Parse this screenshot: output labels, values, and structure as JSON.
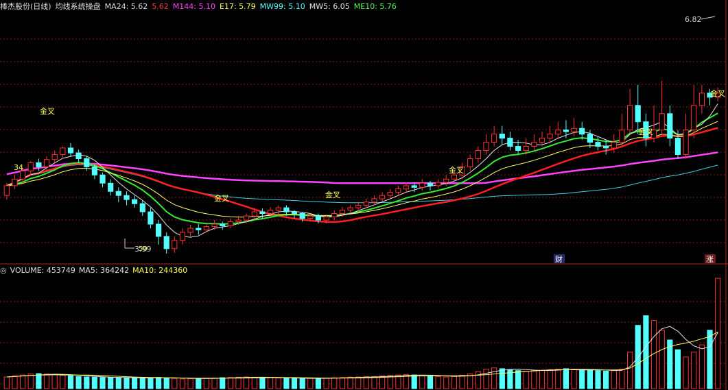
{
  "header": {
    "stock_name": "棒杰股份(日线)",
    "indicator_name": "均线系统操盘",
    "mas": [
      {
        "label": "MA24: 5.62",
        "color": "#dcdcdc"
      },
      {
        "label": "5.62",
        "color": "#ff3b3b"
      },
      {
        "label": "M144: 5.10",
        "color": "#ff44ff"
      },
      {
        "label": "E17: 5.79",
        "color": "#ffff55"
      },
      {
        "label": "MW99: 5.10",
        "color": "#55ffff"
      },
      {
        "label": "MW5: 6.05",
        "color": "#e8e8e8"
      },
      {
        "label": "ME10: 5.76",
        "color": "#55ff55"
      }
    ]
  },
  "annotations": {
    "high_price": "6.82",
    "low_price": "3.99",
    "left_value": "34",
    "low_marker": "50",
    "golden_cross": "金叉",
    "cai_marker": "财",
    "zhang_marker": "涨"
  },
  "volume_header": {
    "volume_label": "VOLUME: 453749",
    "ma5_label": "MA5: 364242",
    "ma10_label": "MA10: 244360"
  },
  "colors": {
    "up": "#ff3232",
    "down": "#54ffff",
    "grid": "#8a1c1c",
    "ma144": "#ff44ff",
    "mw99": "#40d0e0",
    "ma24": "#ff2020",
    "me10": "#33ee33",
    "e17": "#ffff66",
    "mw5": "#e8e8e8"
  },
  "chart_data": {
    "type": "candlestick",
    "price_range": [
      3.99,
      6.82
    ],
    "candles": [
      [
        4.7,
        4.82,
        4.65,
        4.85
      ],
      [
        4.82,
        4.9,
        4.78,
        4.95
      ],
      [
        4.9,
        5.0,
        4.85,
        5.04
      ],
      [
        5.0,
        5.1,
        4.95,
        5.12
      ],
      [
        5.1,
        5.05,
        5.0,
        5.15
      ],
      [
        5.05,
        5.14,
        5.0,
        5.18
      ],
      [
        5.14,
        5.2,
        5.1,
        5.25
      ],
      [
        5.2,
        5.28,
        5.15,
        5.3
      ],
      [
        5.28,
        5.22,
        5.18,
        5.34
      ],
      [
        5.22,
        5.15,
        5.1,
        5.26
      ],
      [
        5.15,
        5.05,
        5.0,
        5.18
      ],
      [
        5.05,
        4.95,
        4.9,
        5.08
      ],
      [
        4.95,
        4.85,
        4.8,
        4.98
      ],
      [
        4.85,
        4.75,
        4.7,
        4.9
      ],
      [
        4.75,
        4.7,
        4.62,
        4.8
      ],
      [
        4.7,
        4.65,
        4.58,
        4.75
      ],
      [
        4.65,
        4.6,
        4.55,
        4.7
      ],
      [
        4.6,
        4.5,
        4.45,
        4.64
      ],
      [
        4.5,
        4.35,
        4.3,
        4.55
      ],
      [
        4.35,
        4.2,
        4.1,
        4.4
      ],
      [
        4.2,
        4.05,
        3.99,
        4.25
      ],
      [
        4.05,
        4.15,
        4.0,
        4.2
      ],
      [
        4.15,
        4.25,
        4.1,
        4.3
      ],
      [
        4.25,
        4.3,
        4.2,
        4.34
      ],
      [
        4.3,
        4.28,
        4.22,
        4.35
      ],
      [
        4.28,
        4.32,
        4.25,
        4.36
      ],
      [
        4.32,
        4.35,
        4.28,
        4.4
      ],
      [
        4.35,
        4.33,
        4.28,
        4.38
      ],
      [
        4.33,
        4.38,
        4.3,
        4.42
      ],
      [
        4.38,
        4.4,
        4.34,
        4.45
      ],
      [
        4.4,
        4.45,
        4.36,
        4.48
      ],
      [
        4.45,
        4.5,
        4.4,
        4.55
      ],
      [
        4.5,
        4.48,
        4.42,
        4.54
      ],
      [
        4.48,
        4.52,
        4.44,
        4.56
      ],
      [
        4.52,
        4.55,
        4.46,
        4.58
      ],
      [
        4.55,
        4.5,
        4.45,
        4.58
      ],
      [
        4.5,
        4.48,
        4.42,
        4.52
      ],
      [
        4.48,
        4.42,
        4.38,
        4.5
      ],
      [
        4.42,
        4.45,
        4.38,
        4.48
      ],
      [
        4.45,
        4.4,
        4.36,
        4.48
      ],
      [
        4.4,
        4.44,
        4.36,
        4.47
      ],
      [
        4.44,
        4.48,
        4.4,
        4.52
      ],
      [
        4.48,
        4.52,
        4.44,
        4.56
      ],
      [
        4.52,
        4.55,
        4.48,
        4.58
      ],
      [
        4.55,
        4.58,
        4.5,
        4.62
      ],
      [
        4.58,
        4.62,
        4.54,
        4.66
      ],
      [
        4.62,
        4.66,
        4.58,
        4.7
      ],
      [
        4.66,
        4.7,
        4.62,
        4.74
      ],
      [
        4.7,
        4.74,
        4.66,
        4.78
      ],
      [
        4.74,
        4.78,
        4.7,
        4.82
      ],
      [
        4.78,
        4.82,
        4.74,
        4.86
      ],
      [
        4.82,
        4.8,
        4.74,
        4.86
      ],
      [
        4.8,
        4.85,
        4.76,
        4.9
      ],
      [
        4.85,
        4.82,
        4.76,
        4.88
      ],
      [
        4.82,
        4.86,
        4.78,
        4.9
      ],
      [
        4.86,
        4.9,
        4.82,
        4.95
      ],
      [
        4.9,
        4.95,
        4.86,
        5.0
      ],
      [
        4.95,
        5.05,
        4.9,
        5.1
      ],
      [
        5.05,
        5.15,
        5.0,
        5.2
      ],
      [
        5.15,
        5.25,
        5.1,
        5.3
      ],
      [
        5.25,
        5.35,
        5.2,
        5.45
      ],
      [
        5.35,
        5.45,
        5.3,
        5.55
      ],
      [
        5.45,
        5.4,
        5.32,
        5.55
      ],
      [
        5.4,
        5.3,
        5.25,
        5.48
      ],
      [
        5.3,
        5.25,
        5.2,
        5.38
      ],
      [
        5.25,
        5.3,
        5.2,
        5.4
      ],
      [
        5.3,
        5.35,
        5.25,
        5.45
      ],
      [
        5.35,
        5.4,
        5.3,
        5.48
      ],
      [
        5.4,
        5.45,
        5.35,
        5.55
      ],
      [
        5.45,
        5.5,
        5.4,
        5.6
      ],
      [
        5.5,
        5.48,
        5.4,
        5.62
      ],
      [
        5.48,
        5.52,
        5.42,
        5.65
      ],
      [
        5.52,
        5.45,
        5.38,
        5.6
      ],
      [
        5.45,
        5.35,
        5.28,
        5.5
      ],
      [
        5.35,
        5.3,
        5.25,
        5.42
      ],
      [
        5.3,
        5.28,
        5.2,
        5.38
      ],
      [
        5.28,
        5.35,
        5.22,
        5.45
      ],
      [
        5.35,
        5.5,
        5.3,
        5.7
      ],
      [
        5.5,
        5.8,
        5.45,
        6.0
      ],
      [
        5.8,
        5.6,
        5.45,
        6.05
      ],
      [
        5.6,
        5.4,
        5.3,
        5.7
      ],
      [
        5.4,
        5.5,
        5.35,
        5.8
      ],
      [
        5.5,
        5.7,
        5.45,
        6.1
      ],
      [
        5.7,
        5.4,
        5.3,
        5.8
      ],
      [
        5.4,
        5.2,
        5.15,
        5.5
      ],
      [
        5.2,
        5.5,
        5.15,
        5.7
      ],
      [
        5.5,
        5.8,
        5.4,
        6.05
      ],
      [
        5.8,
        5.95,
        5.7,
        6.05
      ],
      [
        5.95,
        5.9,
        5.8,
        6.0
      ],
      [
        5.9,
        5.95,
        5.85,
        6.02
      ]
    ],
    "volumes": [
      48000,
      52000,
      56000,
      60000,
      62000,
      60000,
      58000,
      55000,
      53000,
      50000,
      48000,
      47000,
      46000,
      45000,
      45000,
      44000,
      44000,
      43000,
      45000,
      46000,
      44000,
      42000,
      40000,
      41000,
      42000,
      43000,
      44000,
      45000,
      46000,
      47000,
      48000,
      47000,
      46000,
      45000,
      44000,
      43000,
      42000,
      41000,
      42000,
      43000,
      44000,
      45000,
      46000,
      47000,
      48000,
      49000,
      50000,
      52000,
      54000,
      56000,
      58000,
      56000,
      54000,
      52000,
      50000,
      48000,
      50000,
      55000,
      60000,
      70000,
      80000,
      85000,
      82000,
      78000,
      74000,
      72000,
      74000,
      76000,
      78000,
      80000,
      82000,
      80000,
      78000,
      76000,
      74000,
      72000,
      74000,
      80000,
      150000,
      260000,
      300000,
      280000,
      240000,
      200000,
      160000,
      130000,
      150000,
      180000,
      240000,
      453749
    ],
    "ma5_volume": 364242,
    "ma10_volume": 244360
  }
}
